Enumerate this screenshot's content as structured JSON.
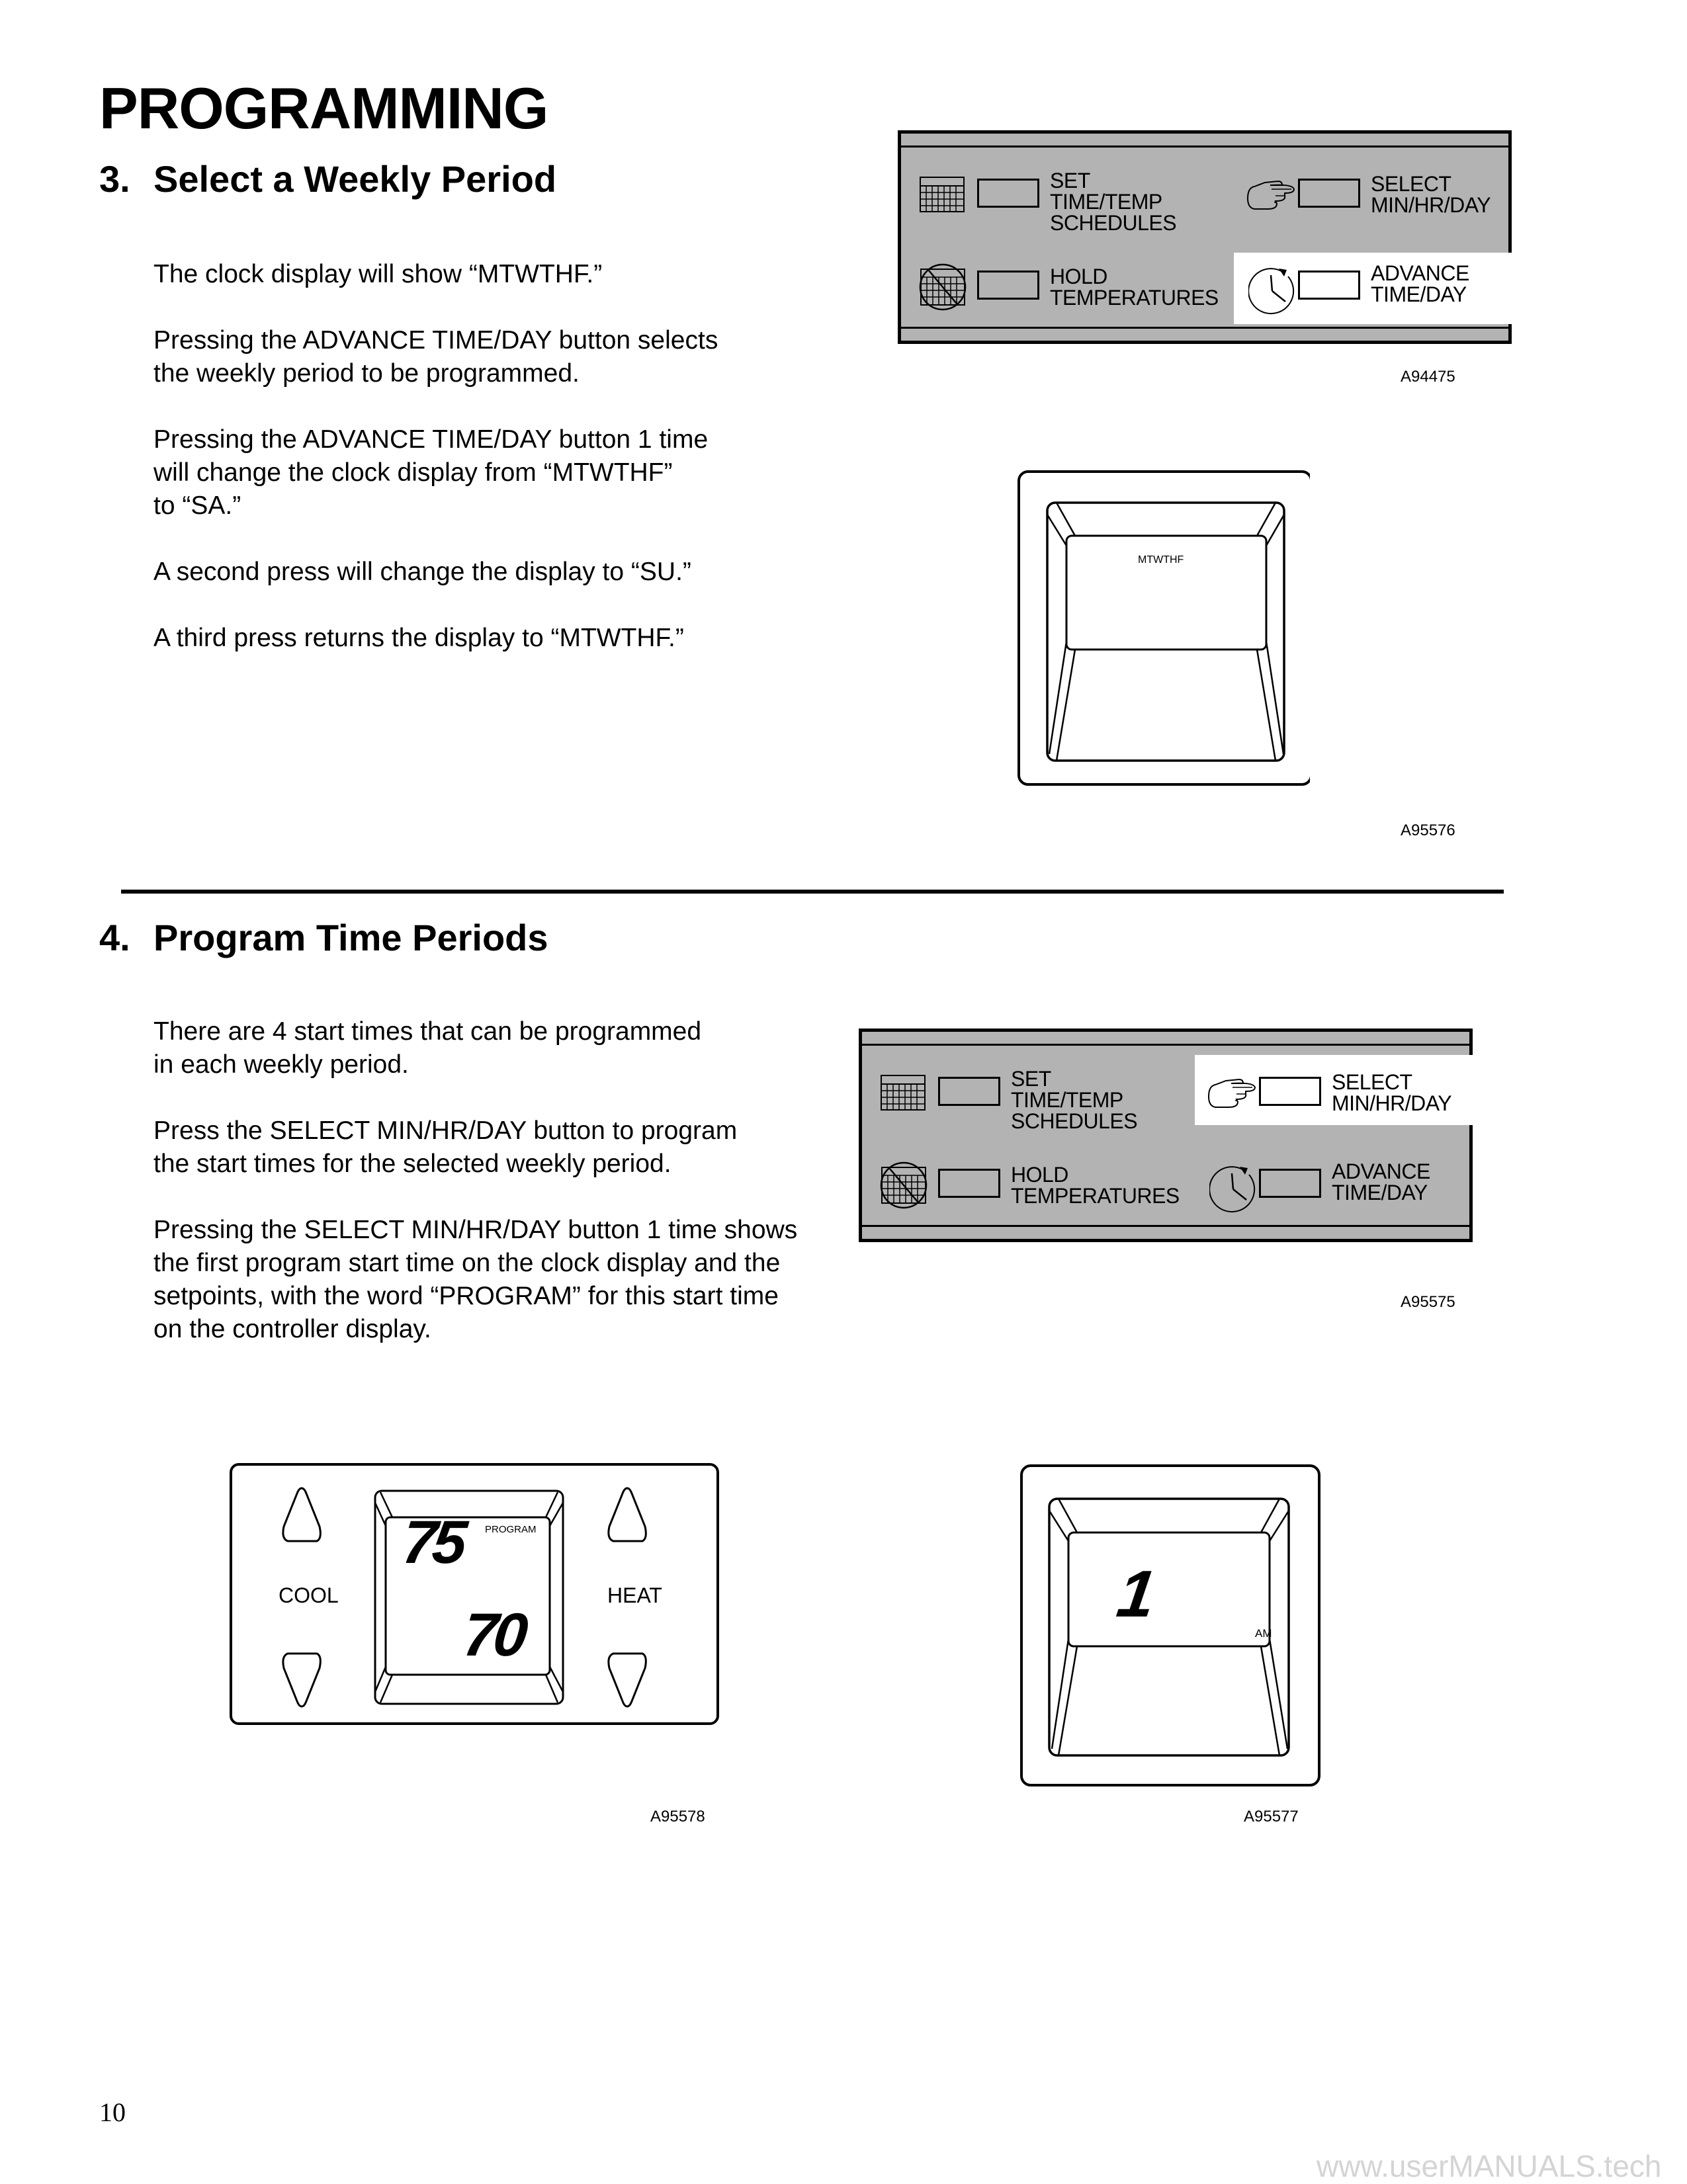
{
  "page": {
    "title": "PROGRAMMING",
    "page_number": "10",
    "watermark": "www.userMANUALS.tech"
  },
  "section3": {
    "number": "3.",
    "title": "Select a Weekly Period",
    "paragraphs": [
      [
        "The clock display will show “MTWTHF.”"
      ],
      [
        "Pressing the ADVANCE TIME/DAY button selects",
        "the weekly period to be programmed."
      ],
      [
        "Pressing the ADVANCE TIME/DAY button 1 time",
        "will change the clock display from “MTWTHF”",
        "to “SA.”"
      ],
      [
        "A second press will change the display to “SU.”"
      ],
      [
        "A third press returns the display to “MTWTHF.”"
      ]
    ],
    "panel_figure": {
      "code": "A94475",
      "highlighted": "advance_time_day",
      "buttons": {
        "set_schedules": [
          "SET",
          "TIME/TEMP",
          "SCHEDULES"
        ],
        "select_min_hr_day": [
          "SELECT",
          "MIN/HR/DAY"
        ],
        "hold_temperatures": [
          "HOLD",
          "TEMPERATURES"
        ],
        "advance_time_day": [
          "ADVANCE",
          "TIME/DAY"
        ]
      },
      "icons": {
        "set_schedules": "calendar-icon",
        "select_min_hr_day": "pointing-hand-icon",
        "hold_temperatures": "calendar-prohibited-icon",
        "advance_time_day": "clock-advance-icon"
      }
    },
    "clock_figure": {
      "code": "A95576",
      "display_text": "MTWTHF"
    }
  },
  "section4": {
    "number": "4.",
    "title": "Program Time Periods",
    "paragraphs": [
      [
        "There are 4 start times that can be programmed",
        "in each weekly period."
      ],
      [
        "Press the SELECT MIN/HR/DAY button to program",
        "the start times for the selected weekly period."
      ],
      [
        "Pressing the SELECT MIN/HR/DAY button 1 time shows",
        "the first program start time on the clock display and the",
        "setpoints, with the word “PROGRAM” for this start time",
        "on the controller display."
      ]
    ],
    "panel_figure": {
      "code": "A95575",
      "highlighted": "select_min_hr_day",
      "buttons": {
        "set_schedules": [
          "SET",
          "TIME/TEMP",
          "SCHEDULES"
        ],
        "select_min_hr_day": [
          "SELECT",
          "MIN/HR/DAY"
        ],
        "hold_temperatures": [
          "HOLD",
          "TEMPERATURES"
        ],
        "advance_time_day": [
          "ADVANCE",
          "TIME/DAY"
        ]
      }
    },
    "controller_figure": {
      "code": "A95578",
      "cool_label": "COOL",
      "heat_label": "HEAT",
      "mode_text": "PROGRAM",
      "cool_setpoint": "75",
      "heat_setpoint": "70"
    },
    "clock_figure": {
      "code": "A95577",
      "time_value": "1",
      "meridiem": "AM"
    }
  },
  "colors": {
    "panel_gray": "#b3b3b3",
    "highlight": "#ffffff",
    "watermark": "#d4d4d4"
  }
}
